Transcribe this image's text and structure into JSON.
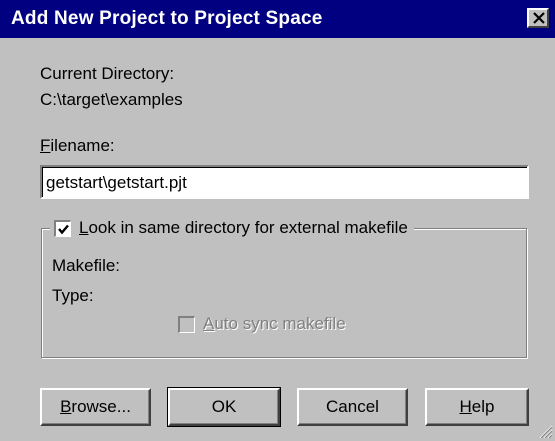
{
  "window": {
    "title": "Add New Project to Project Space"
  },
  "current_directory": {
    "label": "Current Directory:",
    "value": "C:\\target\\examples"
  },
  "filename": {
    "label_accel": "F",
    "label_rest": "ilename:",
    "value": "getstart\\getstart.pjt"
  },
  "makefile_group": {
    "checkbox_checked": true,
    "checkbox_label_accel": "L",
    "checkbox_label_rest": "ook in same directory for external makefile",
    "makefile_label": "Makefile:",
    "type_label": "Type:",
    "auto_sync_checked": false,
    "auto_sync_label_accel": "A",
    "auto_sync_label_rest": "uto sync makefile"
  },
  "buttons": {
    "browse_accel": "B",
    "browse_rest": "rowse...",
    "ok": "OK",
    "cancel": "Cancel",
    "help_accel": "H",
    "help_rest": "elp"
  },
  "colors": {
    "titlebar": "#000080",
    "dialog_face": "#c0c0c0"
  }
}
